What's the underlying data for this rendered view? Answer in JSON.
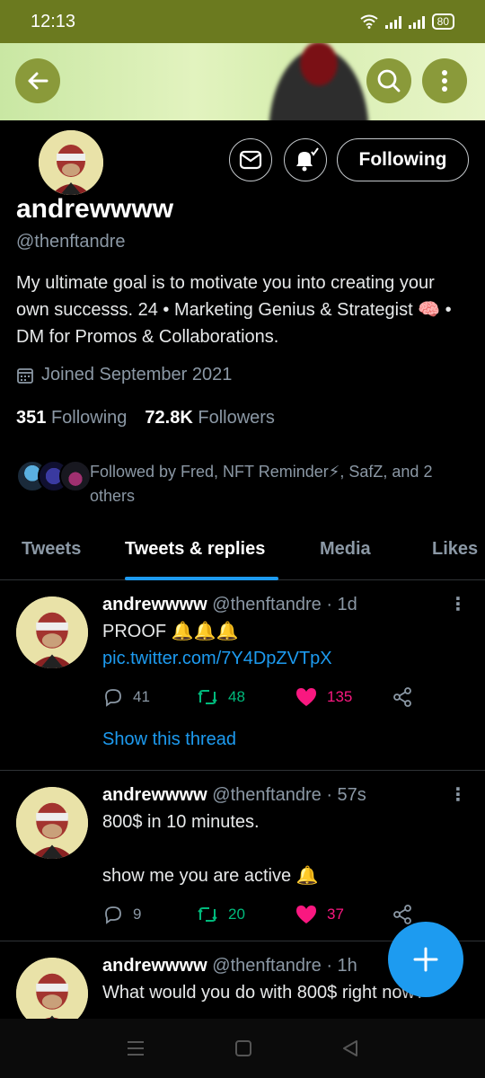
{
  "status_bar": {
    "time": "12:13",
    "battery": "80"
  },
  "profile": {
    "display_name": "andrewwww",
    "handle": "@thenftandre",
    "bio": "My ultimate goal is to motivate you into creating your own successs. 24 • Marketing Genius & Strategist 🧠 • DM for Promos & Collaborations.",
    "joined": "Joined September 2021",
    "following_count": "351",
    "following_label": "Following",
    "followers_count": "72.8K",
    "followers_label": "Followers",
    "followed_by": "Followed by Fred, NFT Reminder⚡, SafZ, and 2 others",
    "following_button": "Following"
  },
  "tabs": [
    {
      "label": "Tweets",
      "active": false
    },
    {
      "label": "Tweets & replies",
      "active": true
    },
    {
      "label": "Media",
      "active": false
    },
    {
      "label": "Likes",
      "active": false
    }
  ],
  "tweets": [
    {
      "name": "andrewwww",
      "meta": "@thenftandre · 1d",
      "text": "PROOF 🔔🔔🔔 ",
      "link": "pic.twitter.com/7Y4DpZVTpX",
      "replies": "41",
      "retweets": "48",
      "likes": "135",
      "show_thread": "Show this thread"
    },
    {
      "name": "andrewwww",
      "meta": "@thenftandre · 57s",
      "text": "800$ in 10 minutes.\n\nshow me you are active 🔔",
      "replies": "9",
      "retweets": "20",
      "likes": "37"
    },
    {
      "name": "andrewwww",
      "meta": "@thenftandre · 1h",
      "text": "What would you do with 800$ right now?"
    }
  ],
  "colors": {
    "accent": "#1d9bf0",
    "retweet": "#00ba7c",
    "like": "#f91880",
    "statusbar": "#6b7a1f"
  }
}
